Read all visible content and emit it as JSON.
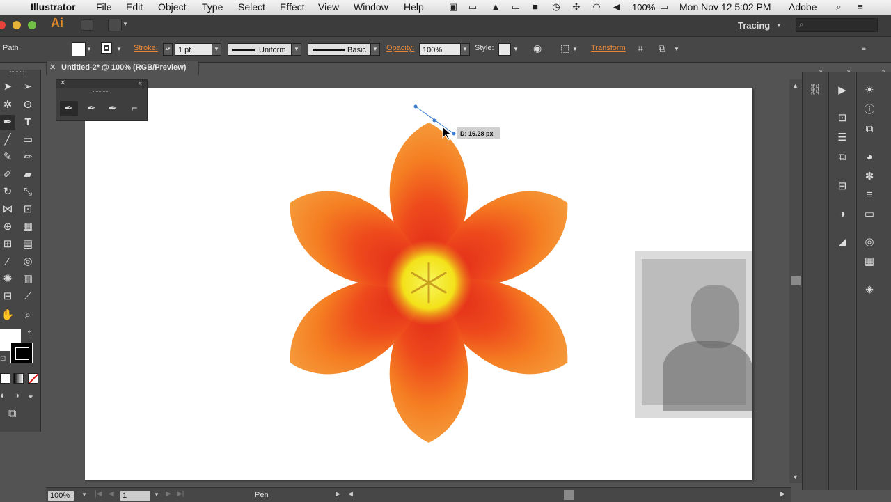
{
  "menubar": {
    "app_name": "Illustrator",
    "items": [
      "File",
      "Edit",
      "Object",
      "Type",
      "Select",
      "Effect",
      "View",
      "Window",
      "Help"
    ],
    "battery": "100%",
    "datetime": "Mon Nov 12  5:02 PM",
    "user": "Adobe"
  },
  "appbar": {
    "logo": "Ai",
    "workspace": "Tracing"
  },
  "control": {
    "selection_label": "Path",
    "stroke_label": "Stroke:",
    "stroke_weight": "1 pt",
    "profile_label": "Uniform",
    "brush_label": "Basic",
    "opacity_label": "Opacity:",
    "opacity_value": "100%",
    "style_label": "Style:",
    "transform_label": "Transform"
  },
  "document": {
    "tab_title": "Untitled-2* @ 100% (RGB/Preview)",
    "pen_tooltip": "D: 16.28 px"
  },
  "status": {
    "zoom": "100%",
    "artboard": "1",
    "tool": "Pen"
  },
  "colors": {
    "accent": "#e5883a",
    "petal_orange": "#f07a1e",
    "petal_red": "#e0251a",
    "center_yellow": "#f5e61a"
  }
}
